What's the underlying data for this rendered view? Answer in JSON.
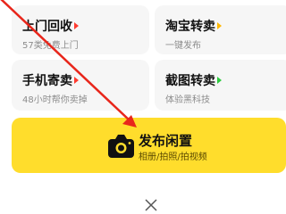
{
  "cards": [
    {
      "title": "上门回收",
      "subtitle": "57类免费上门",
      "arrow_color": "#ff3b30"
    },
    {
      "title": "淘宝转卖",
      "subtitle": "一键发布",
      "arrow_color": "#ffb800"
    },
    {
      "title": "手机寄卖",
      "subtitle": "48小时帮你卖掉",
      "arrow_color": "#ff3b30"
    },
    {
      "title": "截图转卖",
      "subtitle": "体验黑科技",
      "arrow_color": "#2ecc40"
    }
  ],
  "publish": {
    "title": "发布闲置",
    "subtitle": "相册/拍照/拍视频",
    "icon": "camera-icon",
    "background": "#ffdd2c"
  },
  "close": {
    "icon": "close-icon"
  },
  "annotation": {
    "icon": "red-arrow-annotation",
    "color": "#e8261b"
  }
}
